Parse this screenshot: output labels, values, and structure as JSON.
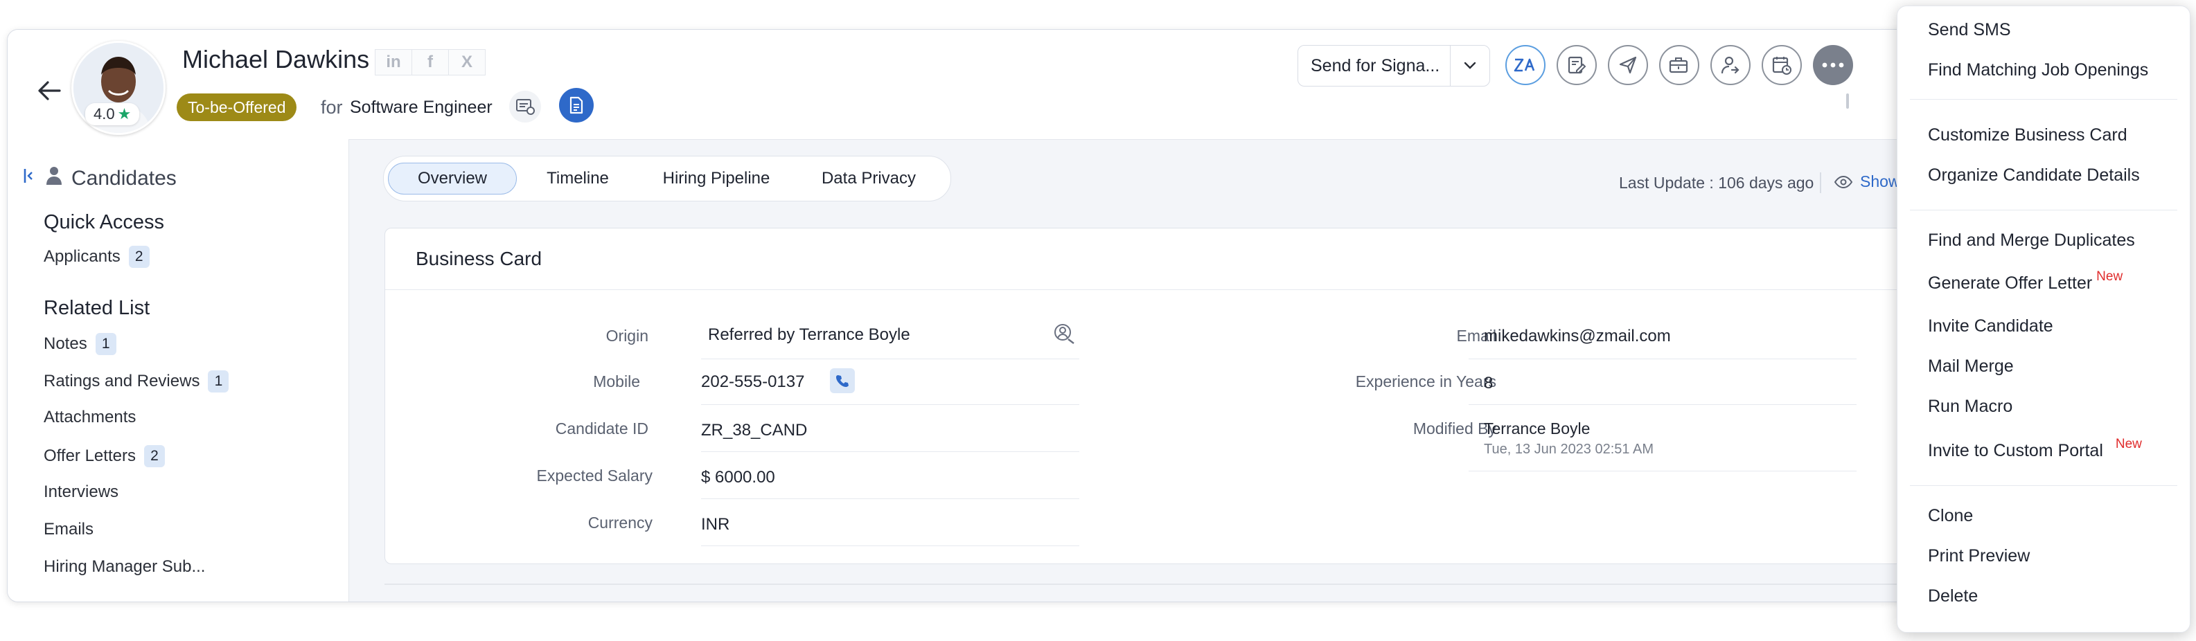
{
  "header": {
    "candidate_name": "Michael Dawkins",
    "rating": "4.0",
    "social": [
      "in",
      "f",
      "X"
    ],
    "status": "To-be-Offered",
    "for_label": "for",
    "job_title": "Software Engineer",
    "send_for_signature": "Send for Signa...",
    "toolbar_icons": [
      "zia-translate-icon",
      "edit-note-icon",
      "send-icon",
      "briefcase-add-icon",
      "user-assign-icon",
      "calendar-schedule-icon",
      "more-options-icon"
    ]
  },
  "sidebar": {
    "module": "Candidates",
    "quick_access_title": "Quick Access",
    "quick_access": [
      {
        "label": "Applicants",
        "count": "2"
      }
    ],
    "related_list_title": "Related List",
    "related": [
      {
        "label": "Notes",
        "count": "1"
      },
      {
        "label": "Ratings and Reviews",
        "count": "1"
      },
      {
        "label": "Attachments",
        "count": ""
      },
      {
        "label": "Offer Letters",
        "count": "2"
      },
      {
        "label": "Interviews",
        "count": ""
      },
      {
        "label": "Emails",
        "count": ""
      },
      {
        "label": "Hiring Manager Sub...",
        "count": ""
      }
    ]
  },
  "tabs": [
    "Overview",
    "Timeline",
    "Hiring Pipeline",
    "Data Privacy"
  ],
  "active_tab": "Overview",
  "last_update": "Last Update : 106 days ago",
  "show_link": "Show",
  "business_card": {
    "title": "Business Card",
    "left_fields": [
      {
        "label": "Origin",
        "value": "Referred by Terrance Boyle"
      },
      {
        "label": "Mobile",
        "value": "202-555-0137"
      },
      {
        "label": "Candidate ID",
        "value": "ZR_38_CAND"
      },
      {
        "label": "Expected Salary",
        "value": "$ 6000.00"
      },
      {
        "label": "Currency",
        "value": "INR"
      }
    ],
    "right_fields": [
      {
        "label": "Email",
        "value": "mikedawkins@zmail.com"
      },
      {
        "label": "Experience in Years",
        "value": "8"
      },
      {
        "label": "Modified By",
        "value": "Terrance Boyle",
        "sub": "Tue, 13 Jun 2023 02:51 AM"
      }
    ]
  },
  "menu": {
    "items": [
      {
        "label": "Send SMS",
        "badge": ""
      },
      {
        "label": "Find Matching Job Openings",
        "badge": ""
      },
      {
        "label": "Customize Business Card",
        "badge": ""
      },
      {
        "label": "Organize Candidate Details",
        "badge": ""
      },
      {
        "label": "Find and Merge Duplicates",
        "badge": ""
      },
      {
        "label": "Generate Offer Letter",
        "badge": "New"
      },
      {
        "label": "Invite Candidate",
        "badge": ""
      },
      {
        "label": "Mail Merge",
        "badge": ""
      },
      {
        "label": "Run Macro",
        "badge": ""
      },
      {
        "label": "Invite to Custom Portal",
        "badge": "New"
      },
      {
        "label": "Clone",
        "badge": ""
      },
      {
        "label": "Print Preview",
        "badge": ""
      },
      {
        "label": "Delete",
        "badge": ""
      }
    ]
  },
  "colors": {
    "status_badge": "#9d8a17",
    "accent": "#2e69c9",
    "new_badge": "#e02c2c",
    "rating_star": "#1aa567"
  }
}
